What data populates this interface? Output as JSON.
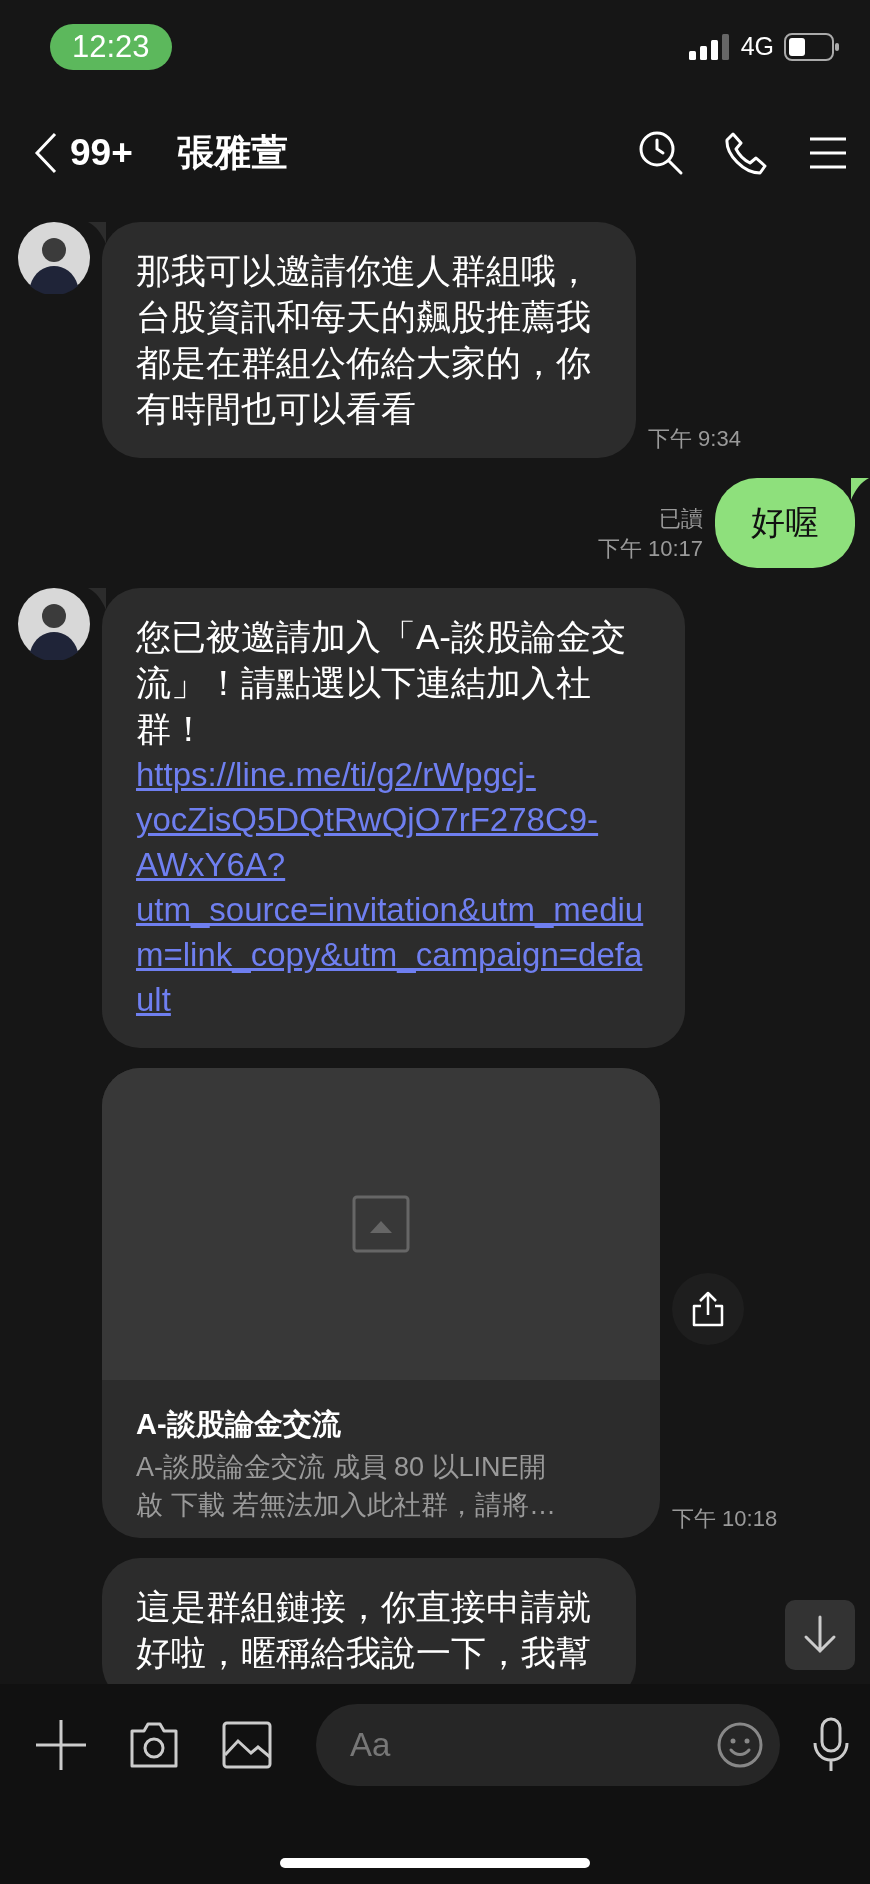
{
  "status_bar": {
    "time": "12:23",
    "network": "4G"
  },
  "header": {
    "back_count": "99+",
    "title": "張雅萱"
  },
  "messages": [
    {
      "kind": "received",
      "avatar": true,
      "text": "那我可以邀請你進人群組哦，台股資訊和每天的飆股推薦我都是在群組公佈給大家的，你有時間也可以看看",
      "time": "下午 9:34"
    },
    {
      "kind": "sent",
      "text": "好喔",
      "read_label": "已讀",
      "time": "下午 10:17"
    },
    {
      "kind": "received",
      "avatar": true,
      "text": "您已被邀請加入「A-談股論金交流」！請點選以下連結加入社群！",
      "link": "https://line.me/ti/g2/rWpgcj-yocZisQ5DQtRwQjO7rF278C9-AWxY6A?utm_source=invitation&utm_medium=link_copy&utm_campaign=default"
    },
    {
      "kind": "link_card",
      "avatar": false,
      "title": "A-談股論金交流",
      "description": "A-談股論金交流 成員 80 以LINE開啟 下載 若無法加入此社群，請將…",
      "time": "下午 10:18"
    },
    {
      "kind": "received",
      "avatar": false,
      "text": "這是群組鏈接，你直接申請就好啦，暱稱給我說一下，我幫"
    }
  ],
  "composer": {
    "placeholder": "Aa"
  }
}
